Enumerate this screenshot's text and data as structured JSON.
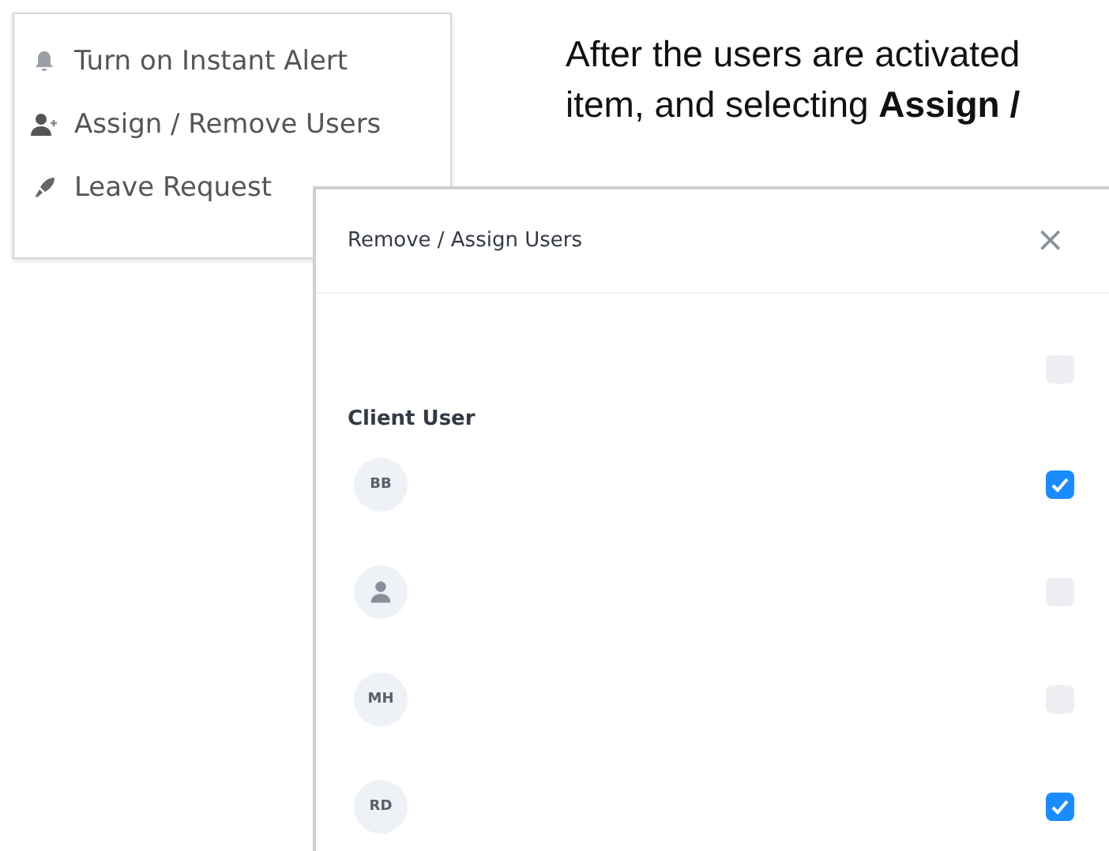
{
  "menu": {
    "items": [
      {
        "label": "Turn on Instant Alert",
        "kind": "alert"
      },
      {
        "label": "Assign / Remove Users",
        "kind": "assign"
      },
      {
        "label": "Leave Request",
        "kind": "leave"
      }
    ]
  },
  "instruction": {
    "lines": [
      "After the users are activated",
      "item, and selecting **Assign /**"
    ]
  },
  "dialog": {
    "title": "Remove / Assign Users",
    "close": "×",
    "select_all": {
      "checked": false
    },
    "section": "Client User",
    "users": [
      {
        "kind": "initials",
        "initials": "BB",
        "checked": true
      },
      {
        "kind": "silhouette",
        "checked": false
      },
      {
        "kind": "initials",
        "initials": "MH",
        "checked": false
      },
      {
        "kind": "initials",
        "initials": "RD",
        "checked": true
      }
    ]
  }
}
